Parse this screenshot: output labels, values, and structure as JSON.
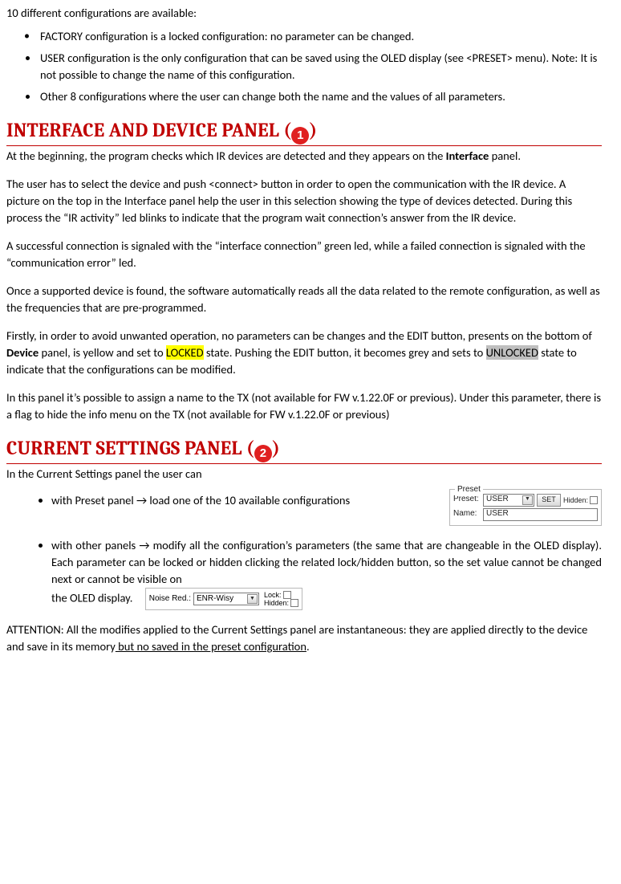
{
  "intro": "10 different configurations are available:",
  "bullets": [
    "FACTORY configuration is a locked configuration: no parameter can be changed.",
    "USER configuration is the only configuration that can be saved using the OLED display (see <PRESET>  menu). Note: It is not possible to change the name of this configuration.",
    "Other 8 configurations where the user can change both the name and the values of all parameters."
  ],
  "h1": {
    "pre": "INTERFACE AND DEVICE PANEL (",
    "num": "1",
    "post": ")"
  },
  "p1a_pre": "At the beginning, the program checks which IR devices are detected and they appears on the ",
  "p1a_bold": "Interface",
  "p1a_post": " panel.",
  "p1b": "The user has to select the device and push <connect> button in order to open the communication with the IR device. A picture on the top in the Interface panel help the user in this selection showing the type of devices detected. During this process the “IR activity” led blinks to indicate that the program wait connection’s answer from the IR device.",
  "p1c": "A successful connection is signaled with the “interface connection” green led, while a failed connection is signaled with the “communication error” led.",
  "p1d": "Once a supported device is found, the software automatically reads all the data related to the remote configuration, as well as the frequencies that are pre-programmed.",
  "p1e_1": "Firstly, in order to avoid unwanted operation, no parameters can be changes and the EDIT button, presents on the bottom of ",
  "p1e_bold": "Device",
  "p1e_2": " panel, is yellow and set to ",
  "p1e_lock": "LOCKED",
  "p1e_3": " state.  Pushing the EDIT button, it becomes grey and sets to ",
  "p1e_unlock": "UNLOCKED",
  "p1e_4": " state to indicate that the configurations can be modified.",
  "p1f": "In this panel it’s possible to assign a name to the TX (not available for FW v.1.22.0F or previous). Under this parameter, there is a flag to hide the info menu on the TX (not available for FW v.1.22.0F or previous)",
  "h2": {
    "pre": "CURRENT SETTINGS PANEL (",
    "num": "2",
    "post": ")"
  },
  "p2a": "In the Current Settings panel the user can",
  "li2_1": "with Preset panel → load one of the 10 available configurations",
  "li2_2a": "with other panels → modify all the configuration’s parameters (the same that are changeable in the OLED display). Each parameter can be locked or hidden clicking the related lock/hidden button, so the set value cannot be changed next or cannot be visible on ",
  "li2_2b": "the OLED display.",
  "preset": {
    "legend": "Preset",
    "lbl_preset": "Preset:",
    "combo_val": "USER",
    "btn_set": "SET",
    "lbl_hidden": "Hidden:",
    "lbl_name": "Name:",
    "name_val": "USER"
  },
  "noise": {
    "lbl": "Noise Red.:",
    "val": "ENR-Wisy",
    "lock": "Lock:",
    "hidden": "Hidden:"
  },
  "attn_1": "ATTENTION: All the modifies applied to the Current Settings panel are instantaneous: they are applied directly to the device and save in its memory",
  "attn_2": " but no saved in the preset configuration",
  "attn_3": "."
}
